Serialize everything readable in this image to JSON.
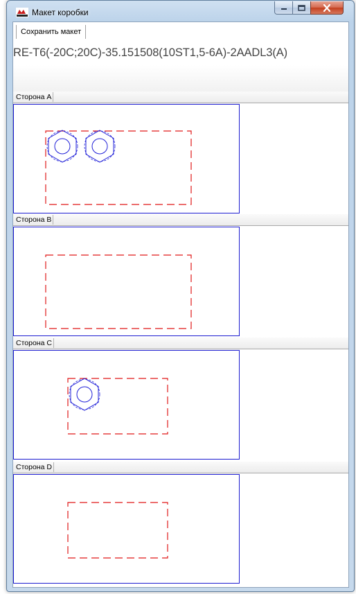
{
  "window": {
    "title": "Макет коробки",
    "controls": [
      "minimize",
      "maximize",
      "close"
    ]
  },
  "toolbar": {
    "save_layout_label": "Сохранить макет"
  },
  "product_code": "RE-T6(-20C;20C)-35.151508(10ST1,5-6A)-2AADL3(A)",
  "colors": {
    "frame_border": "#1a1ad0",
    "cutout_dash": "#e01818",
    "gland": "#2020d8"
  },
  "sides": [
    {
      "label": "Сторона A",
      "gland_count": 2
    },
    {
      "label": "Сторона B",
      "gland_count": 0
    },
    {
      "label": "Сторона C",
      "gland_count": 1
    },
    {
      "label": "Сторона D",
      "gland_count": 0
    }
  ]
}
